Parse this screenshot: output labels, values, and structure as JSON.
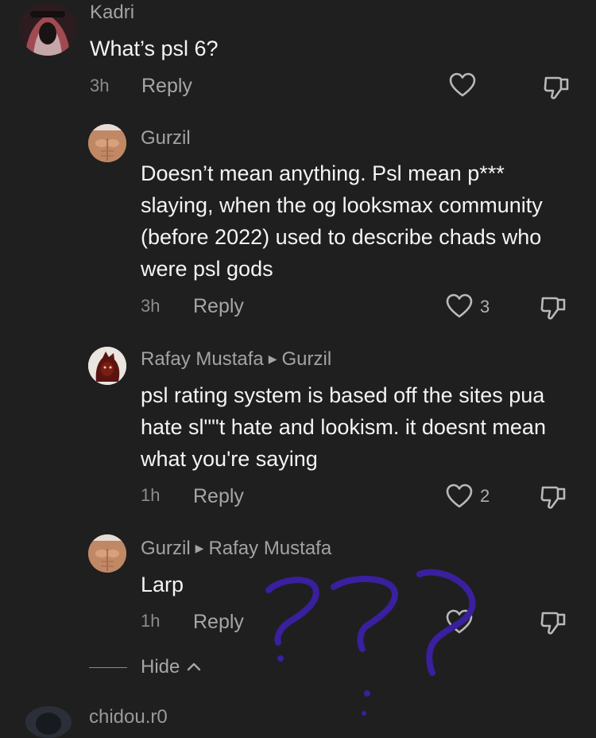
{
  "comments": [
    {
      "author": "Kadri",
      "text": "What’s psl 6?",
      "time": "3h",
      "reply_label": "Reply"
    },
    {
      "author": "Gurzil",
      "text": "Doesn’t mean anything. Psl mean p*** slaying, when the og looksmax community (before 2022) used to describe chads who were psl gods",
      "time": "3h",
      "reply_label": "Reply",
      "likes": "3"
    },
    {
      "author": "Rafay Mustafa",
      "reply_to": "Gurzil",
      "text": "psl rating system is based off the sites pua hate sl\"\"t hate and lookism. it doesnt mean what you're saying",
      "time": "1h",
      "reply_label": "Reply",
      "likes": "2"
    },
    {
      "author": "Gurzil",
      "reply_to": "Rafay Mustafa",
      "text": "Larp",
      "time": "1h",
      "reply_label": "Reply"
    }
  ],
  "hide_label": "Hide",
  "next_author_partial": "chidou.r0",
  "icons": {
    "like": "heart-outline-icon",
    "dislike": "thumbs-down-outline-icon",
    "hide": "chevron-up-icon",
    "reply_arrow": "triangle-right-icon"
  },
  "colors": {
    "background": "#1f1f1f",
    "scribble": "#3a1f9e"
  }
}
